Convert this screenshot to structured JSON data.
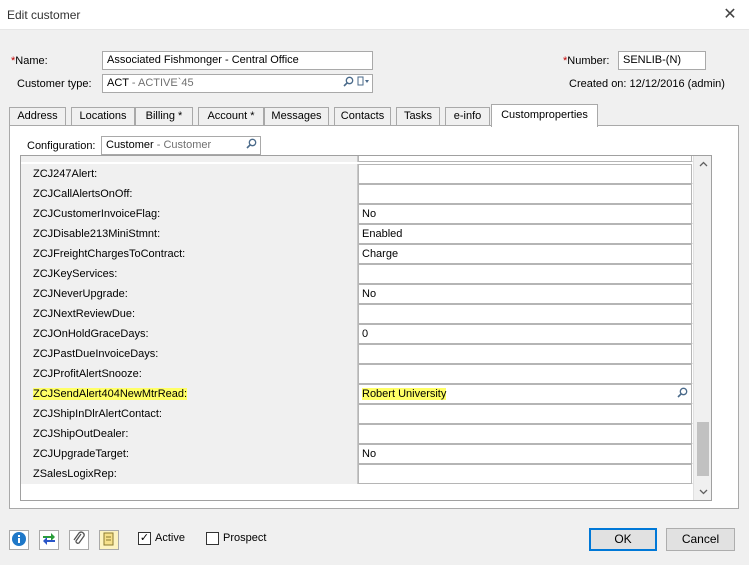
{
  "window": {
    "title": "Edit customer",
    "close_glyph": "✕"
  },
  "header": {
    "name_label_req": "*",
    "name_label": "Name:",
    "name_value": "Associated Fishmonger - Central Office",
    "type_label": "Customer type:",
    "type_code": "ACT",
    "type_desc": " - ACTIVE`45",
    "number_label_req": "*",
    "number_label": "Number:",
    "number_value": "SENLIB-(N)",
    "created_label": "Created on: 12/12/2016 (admin)"
  },
  "tabs": [
    {
      "label": "Address"
    },
    {
      "label": "Locations"
    },
    {
      "label": "Billing *"
    },
    {
      "label": "Account *"
    },
    {
      "label": "Messages"
    },
    {
      "label": "Contacts"
    },
    {
      "label": "Tasks"
    },
    {
      "label": "e-info"
    },
    {
      "label": "Customproperties",
      "active": true
    }
  ],
  "config": {
    "label": "Configuration:",
    "value": "Customer",
    "value_desc": " - Customer"
  },
  "properties": [
    {
      "name": "ZCJ247Alert:",
      "value": ""
    },
    {
      "name": "ZCJCallAlertsOnOff:",
      "value": ""
    },
    {
      "name": "ZCJCustomerInvoiceFlag:",
      "value": "No"
    },
    {
      "name": "ZCJDisable213MiniStmnt:",
      "value": "Enabled"
    },
    {
      "name": "ZCJFreightChargesToContract:",
      "value": "Charge"
    },
    {
      "name": "ZCJKeyServices:",
      "value": ""
    },
    {
      "name": "ZCJNeverUpgrade:",
      "value": "No"
    },
    {
      "name": "ZCJNextReviewDue:",
      "value": ""
    },
    {
      "name": "ZCJOnHoldGraceDays:",
      "value": "0"
    },
    {
      "name": "ZCJPastDueInvoiceDays:",
      "value": ""
    },
    {
      "name": "ZCJProfitAlertSnooze:",
      "value": ""
    },
    {
      "name": "ZCJSendAlert404NewMtrRead:",
      "value": "Robert University",
      "highlighted": true
    },
    {
      "name": "ZCJShipInDlrAlertContact:",
      "value": ""
    },
    {
      "name": "ZCJShipOutDealer:",
      "value": ""
    },
    {
      "name": "ZCJUpgradeTarget:",
      "value": "No"
    },
    {
      "name": "ZSalesLogixRep:",
      "value": ""
    }
  ],
  "footer": {
    "active_label": "Active",
    "active_checked": true,
    "active_mark": "✓",
    "prospect_label": "Prospect",
    "prospect_checked": false,
    "ok_label": "OK",
    "cancel_label": "Cancel"
  },
  "icons": {
    "info": "info-icon",
    "sync": "sync-arrows-icon",
    "attach": "paperclip-icon",
    "notes": "notes-icon",
    "lookup": "magnifier-icon",
    "dropdown": "dropdown-icon"
  },
  "colors": {
    "highlight": "#ffff66",
    "required": "#c00000",
    "ok_border": "#0078d7",
    "info_blue": "#1f78c8",
    "sync_green": "#2a9d3a"
  }
}
